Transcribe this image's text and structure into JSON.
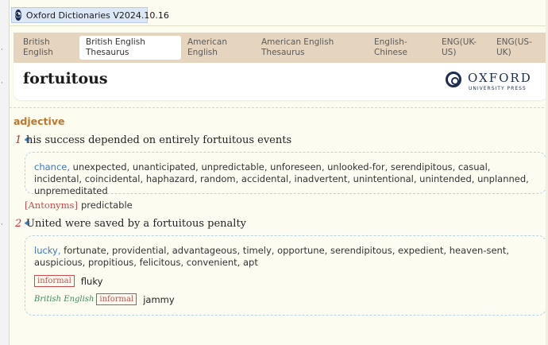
{
  "window": {
    "title": "Oxford Dictionaries V2024.10.16"
  },
  "tabs": [
    {
      "label": "British English",
      "active": false
    },
    {
      "label": "British English Thesaurus",
      "active": true
    },
    {
      "label": "American English",
      "active": false
    },
    {
      "label": "American English Thesaurus",
      "active": false
    },
    {
      "label": "English-Chinese",
      "active": false
    },
    {
      "label": "ENG(UK-US)",
      "active": false
    },
    {
      "label": "ENG(US-UK)",
      "active": false
    }
  ],
  "entry": {
    "headword": "fortuitous",
    "logo": {
      "name": "OXFORD",
      "sub": "UNIVERSITY PRESS"
    },
    "part_of_speech": "adjective",
    "senses": [
      {
        "number": "1",
        "speaker_icon": "speaker-icon",
        "example": "his success depended on entirely fortuitous events",
        "first_synonym": "chance,",
        "synonyms": " unexpected, unanticipated, unpredictable, unforeseen, unlooked-for, serendipitous, casual, incidental, coincidental, haphazard, random, accidental, inadvertent, unintentional, unintended, unplanned, unpremeditated",
        "antonyms_label": "[Antonyms]",
        "antonyms": "predictable"
      },
      {
        "number": "2",
        "speaker_icon": "speaker-icon",
        "example": "United were saved by a fortuitous penalty",
        "first_synonym": "lucky,",
        "synonyms": " fortunate, providential, advantageous, timely, opportune, serendipitous, expedient, heaven-sent, auspicious, propitious, felicitous, convenient, apt",
        "registers": [
          {
            "region": "",
            "label": "informal",
            "word": "fluky"
          },
          {
            "region": "British English",
            "label": "informal",
            "word": "jammy"
          }
        ]
      }
    ]
  },
  "colors": {
    "tab_bar": "#e6d5be",
    "part_of_speech": "#c0752a",
    "sense_number": "#c52d2d",
    "synonym_link": "#3a78c2",
    "register": "#c84a4a",
    "region": "#3f8a5e"
  }
}
